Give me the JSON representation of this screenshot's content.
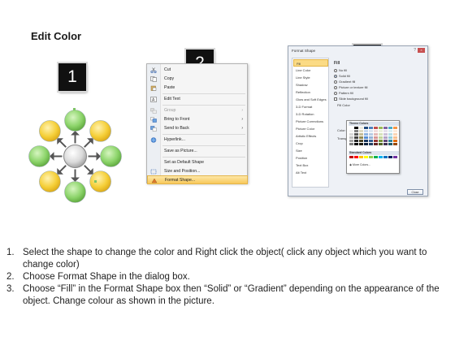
{
  "title": "Edit Color",
  "steps": {
    "one": "1",
    "two": "2",
    "three": "3"
  },
  "colors": {
    "green": "#8cd46a",
    "yellow": "#f5cf38",
    "highlight": "#f8c85a",
    "badge": "#111111"
  },
  "context_menu": {
    "items": [
      {
        "label": "Cut",
        "icon": "scissors-icon",
        "disabled": false
      },
      {
        "label": "Copy",
        "icon": "copy-icon",
        "disabled": false
      },
      {
        "label": "Paste",
        "icon": "paste-icon",
        "disabled": false
      },
      {
        "label": "Edit Text",
        "icon": "edit-text-icon",
        "disabled": false
      },
      {
        "label": "Group",
        "icon": "group-icon",
        "disabled": true
      },
      {
        "label": "Bring to Front",
        "icon": "bring-front-icon",
        "disabled": false
      },
      {
        "label": "Send to Back",
        "icon": "send-back-icon",
        "disabled": false
      },
      {
        "label": "Hyperlink...",
        "icon": "hyperlink-icon",
        "disabled": false
      },
      {
        "label": "Save as Picture...",
        "icon": "",
        "disabled": false
      },
      {
        "label": "Set as Default Shape",
        "icon": "",
        "disabled": false
      },
      {
        "label": "Size and Position...",
        "icon": "size-icon",
        "disabled": false
      },
      {
        "label": "Format Shape...",
        "icon": "format-shape-icon",
        "disabled": false,
        "highlighted": true
      }
    ]
  },
  "format_dialog": {
    "title": "Format Shape",
    "categories": [
      "Fill",
      "Line Color",
      "Line Style",
      "Shadow",
      "Reflection",
      "Glow and Soft Edges",
      "3-D Format",
      "3-D Rotation",
      "Picture Corrections",
      "Picture Color",
      "Artistic Effects",
      "Crop",
      "Size",
      "Position",
      "Text Box",
      "Alt Text"
    ],
    "fill_heading": "Fill",
    "options": [
      "No fill",
      "Solid fill",
      "Gradient fill",
      "Picture or texture fill",
      "Pattern fill",
      "Slide background fill"
    ],
    "fill_color_label": "Fill Color",
    "color_label": "Color:",
    "transparency_label": "Transpa",
    "theme_colors_label": "Theme Colors",
    "standard_colors_label": "Standard Colors",
    "more_colors_label": "More Colors...",
    "close_button": "Close"
  },
  "instructions": [
    {
      "num": "1.",
      "text": "Select the shape to change the color and Right click the object( click any object which you want to change color)"
    },
    {
      "num": "2.",
      "text": "Choose Format Shape in the dialog box."
    },
    {
      "num": "3.",
      "text": "Choose “Fill” in the Format Shape box then “Solid” or “Gradient” depending on the appearance of the object. Change colour as shown in the picture."
    }
  ]
}
